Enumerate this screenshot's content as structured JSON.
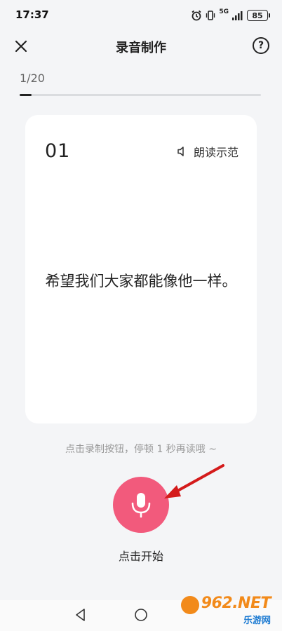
{
  "status_bar": {
    "time": "17:37",
    "network": "5G",
    "battery": "85",
    "icons": [
      "alarm-icon",
      "vibrate-icon",
      "signal-icon"
    ]
  },
  "header": {
    "title": "录音制作",
    "help": "?",
    "close_icon": "close-icon"
  },
  "progress": {
    "text": "1/20",
    "current": 1,
    "total": 20
  },
  "card": {
    "number": "01",
    "demo_label": "朗读示范",
    "demo_icon": "speaker-icon",
    "sentence": "希望我们大家都能像他一样。"
  },
  "hint": "点击录制按钮，停顿 1 秒再读哦 ~",
  "record": {
    "label": "点击开始",
    "icon": "microphone-icon",
    "color": "#f25a7c"
  },
  "annotation": {
    "arrow_color": "#d41b1b"
  },
  "watermark": {
    "text": "962.NET",
    "sub": "乐游网"
  },
  "nav": {
    "icons": [
      "nav-back-icon",
      "nav-home-icon"
    ]
  }
}
